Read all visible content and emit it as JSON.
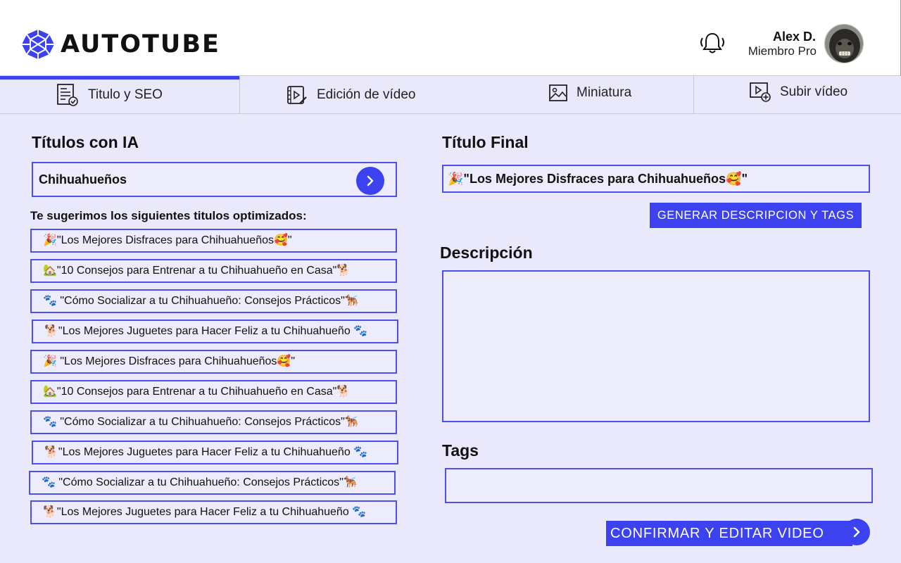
{
  "header": {
    "brand": "AUTOTUBE",
    "user": {
      "name": "Alex D.",
      "role": "Miembro Pro"
    }
  },
  "tabs": [
    {
      "label": "Titulo y SEO",
      "icon": "document-check-icon",
      "active": true
    },
    {
      "label": "Edición de vídeo",
      "icon": "video-edit-icon",
      "active": false
    },
    {
      "label": "Miniatura",
      "icon": "image-icon",
      "active": false
    },
    {
      "label": "Subir vídeo",
      "icon": "upload-video-icon",
      "active": false
    }
  ],
  "left": {
    "title": "Títulos con IA",
    "seed_value": "Chihuahueños",
    "suggest_label": "Te sugerimos los siguientes titulos optimizados:",
    "suggestions": [
      "🎉\"Los Mejores Disfraces para Chihuahueños🥰\"",
      "🏡\"10 Consejos para Entrenar a tu Chihuahueño en Casa\"🐕",
      "🐾 \"Cómo Socializar a tu Chihuahueño: Consejos Prácticos\"🐕‍🦺",
      "🐕\"Los Mejores Juguetes para Hacer Feliz a tu Chihuahueño 🐾",
      "🎉 \"Los Mejores Disfraces para Chihuahueños🥰\"",
      "🏡\"10 Consejos para Entrenar a tu Chihuahueño en Casa\"🐕",
      "🐾 \"Cómo Socializar a tu Chihuahueño: Consejos Prácticos\"🐕‍🦺",
      "🐕\"Los Mejores Juguetes para Hacer Feliz a tu Chihuahueño 🐾",
      "🐾 \"Cómo Socializar a tu Chihuahueño: Consejos Prácticos\"🐕‍🦺",
      "🐕\"Los Mejores Juguetes para Hacer Feliz a tu Chihuahueño 🐾"
    ]
  },
  "right": {
    "final_title_heading": "Título Final",
    "final_title_value": "🎉\"Los Mejores Disfraces para Chihuahueños🥰\"",
    "generate_button": "GENERAR  DESCRIPCION Y TAGS",
    "description_heading": "Descripción",
    "description_value": "",
    "tags_heading": "Tags",
    "tags_value": "",
    "confirm_button": "CONFIRMAR Y EDITAR VIDEO"
  },
  "colors": {
    "accent": "#3c42f0",
    "background": "#e9e9fb",
    "field_border": "#4a50e8"
  }
}
